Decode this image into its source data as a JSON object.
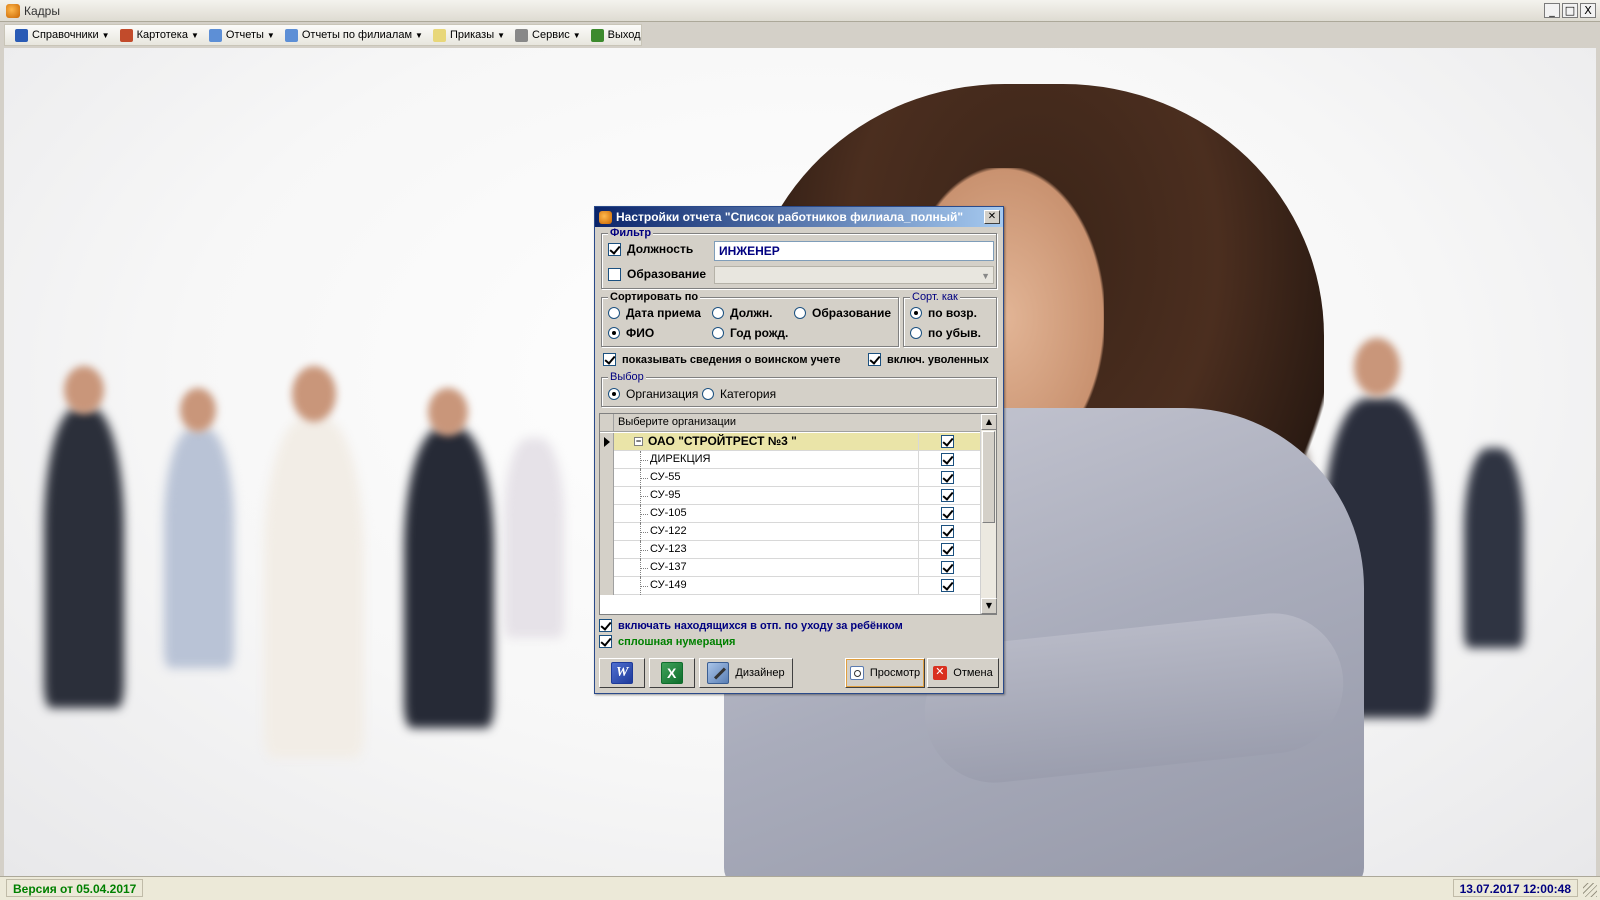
{
  "window": {
    "title": "Кадры",
    "buttons": [
      "_",
      "□",
      "X"
    ]
  },
  "menu": [
    {
      "label": "Справочники",
      "icon": "book-icon",
      "color": "#2a5bb5",
      "dropdown": true
    },
    {
      "label": "Картотека",
      "icon": "people-icon",
      "color": "#c24b2b",
      "dropdown": true
    },
    {
      "label": "Отчеты",
      "icon": "report-icon",
      "color": "#5d8fd6",
      "dropdown": true
    },
    {
      "label": "Отчеты по филиалам",
      "icon": "report-icon",
      "color": "#5d8fd6",
      "dropdown": true
    },
    {
      "label": "Приказы",
      "icon": "document-icon",
      "color": "#e8d77a",
      "dropdown": true
    },
    {
      "label": "Сервис",
      "icon": "gear-icon",
      "color": "#888888",
      "dropdown": true
    },
    {
      "label": "Выход",
      "icon": "exit-icon",
      "color": "#3c8a2d",
      "dropdown": false
    }
  ],
  "dialog": {
    "title": "Настройки отчета  \"Список работников филиала_полный\"",
    "filter": {
      "legend": "Фильтр",
      "position_label": "Должность",
      "position_checked": true,
      "position_value": "ИНЖЕНЕР",
      "education_label": "Образование",
      "education_checked": false,
      "education_value": ""
    },
    "sort_by": {
      "legend": "Сортировать по",
      "options": [
        "Дата приема",
        "Должн.",
        "Образование",
        "ФИО",
        "Год рожд."
      ],
      "selected": "ФИО"
    },
    "sort_order": {
      "legend": "Сорт. как",
      "options": [
        "по возр.",
        "по убыв."
      ],
      "selected": "по возр."
    },
    "show_military": {
      "label": "показывать сведения о воинском учете",
      "checked": true
    },
    "include_fired": {
      "label": "включ. уволенных",
      "checked": true
    },
    "selection": {
      "legend": "Выбор",
      "options": [
        "Организация",
        "Категория"
      ],
      "selected": "Организация"
    },
    "org_tree": {
      "header": "Выберите организации",
      "root": {
        "name": "ОАО \"СТРОЙТРЕСТ №3 \"",
        "checked": true,
        "expander": "−"
      },
      "children": [
        {
          "name": "ДИРЕКЦИЯ",
          "checked": true
        },
        {
          "name": "СУ-55",
          "checked": true
        },
        {
          "name": "СУ-95",
          "checked": true
        },
        {
          "name": "СУ-105",
          "checked": true
        },
        {
          "name": "СУ-122",
          "checked": true
        },
        {
          "name": "СУ-123",
          "checked": true
        },
        {
          "name": "СУ-137",
          "checked": true
        },
        {
          "name": "СУ-149",
          "checked": true
        }
      ]
    },
    "include_maternity": {
      "label": "включать находящихся в отп. по уходу за ребёнком",
      "checked": true,
      "color": "#000080"
    },
    "continuous_numbering": {
      "label": "сплошная нумерация",
      "checked": true,
      "color": "#008000"
    },
    "buttons": {
      "word": "word-icon",
      "excel": "excel-icon",
      "designer": "Дизайнер",
      "preview": "Просмотр",
      "cancel": "Отмена"
    }
  },
  "status": {
    "version": "Версия от 05.04.2017",
    "datetime": "13.07.2017 12:00:48"
  }
}
